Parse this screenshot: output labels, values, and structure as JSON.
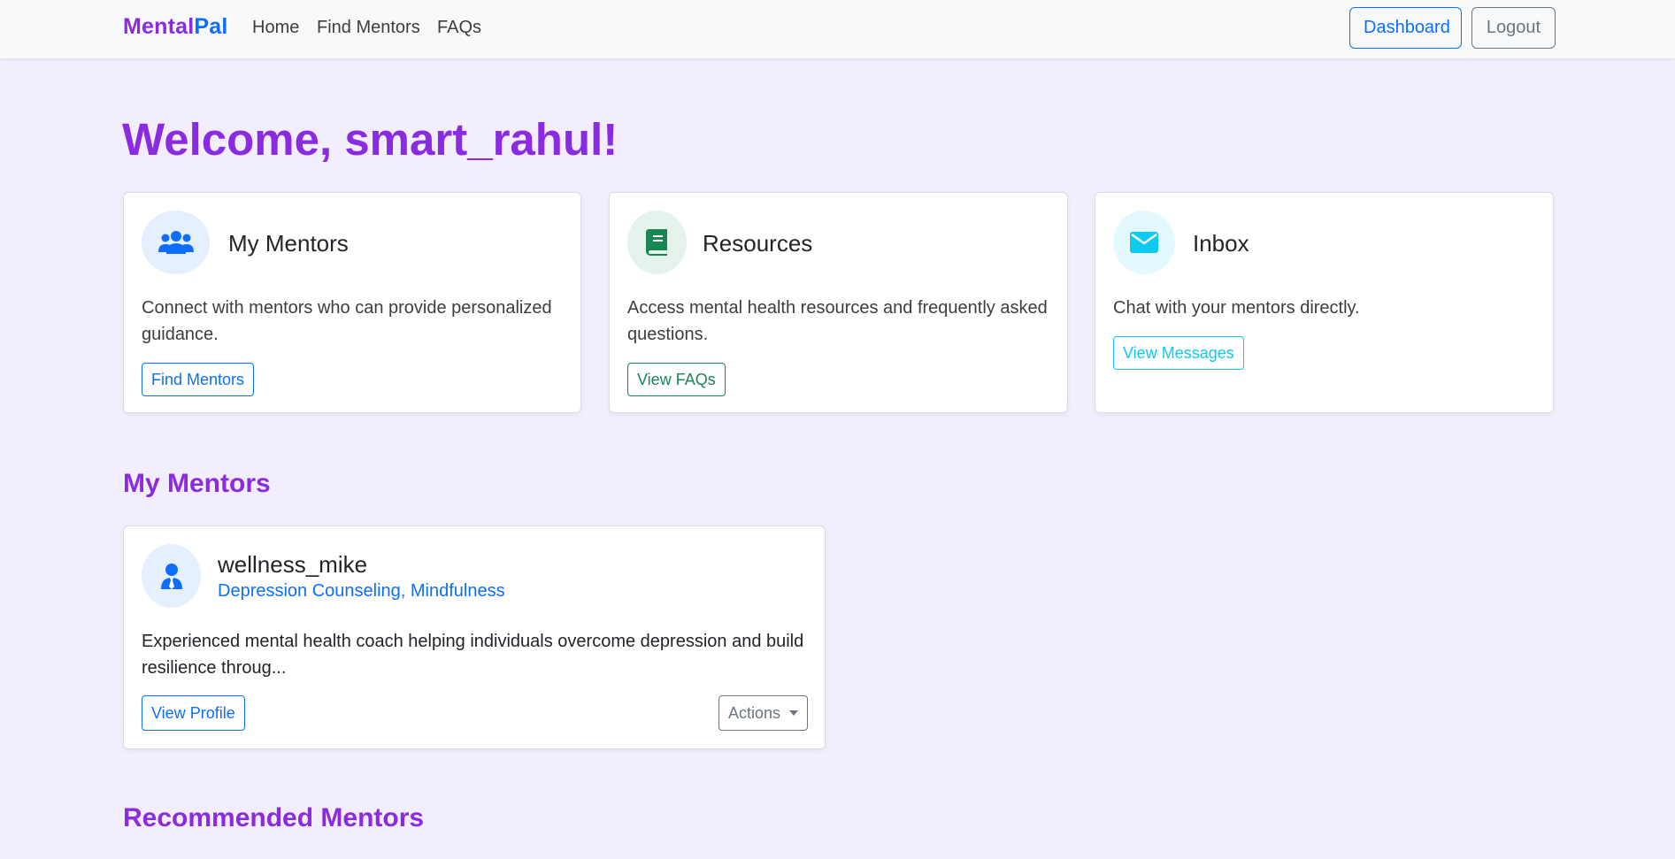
{
  "navbar": {
    "brand_part1": "Mental",
    "brand_part2": "Pal",
    "links": [
      "Home",
      "Find Mentors",
      "FAQs"
    ],
    "dashboard_label": "Dashboard",
    "logout_label": "Logout"
  },
  "welcome": "Welcome, smart_rahul!",
  "cards": [
    {
      "title": "My Mentors",
      "text": "Connect with mentors who can provide personalized guidance.",
      "button": "Find Mentors",
      "icon": "users-icon",
      "color": "#0d6efd"
    },
    {
      "title": "Resources",
      "text": "Access mental health resources and frequently asked questions.",
      "button": "View FAQs",
      "icon": "book-icon",
      "color": "#198754"
    },
    {
      "title": "Inbox",
      "text": "Chat with your mentors directly.",
      "button": "View Messages",
      "icon": "envelope-icon",
      "color": "#0dcaf0"
    }
  ],
  "my_mentors_title": "My Mentors",
  "mentor": {
    "name": "wellness_mike",
    "specialties": "Depression Counseling, Mindfulness",
    "bio": "Experienced mental health coach helping individuals overcome depression and build resilience throug...",
    "view_profile_label": "View Profile",
    "actions_label": "Actions",
    "icon": "user-tie-icon"
  },
  "recommended_title": "Recommended Mentors",
  "colors": {
    "accent": "#8a2be2",
    "primary": "#0d6efd",
    "success": "#198754",
    "info": "#0dcaf0",
    "background": "#f3eefd"
  }
}
